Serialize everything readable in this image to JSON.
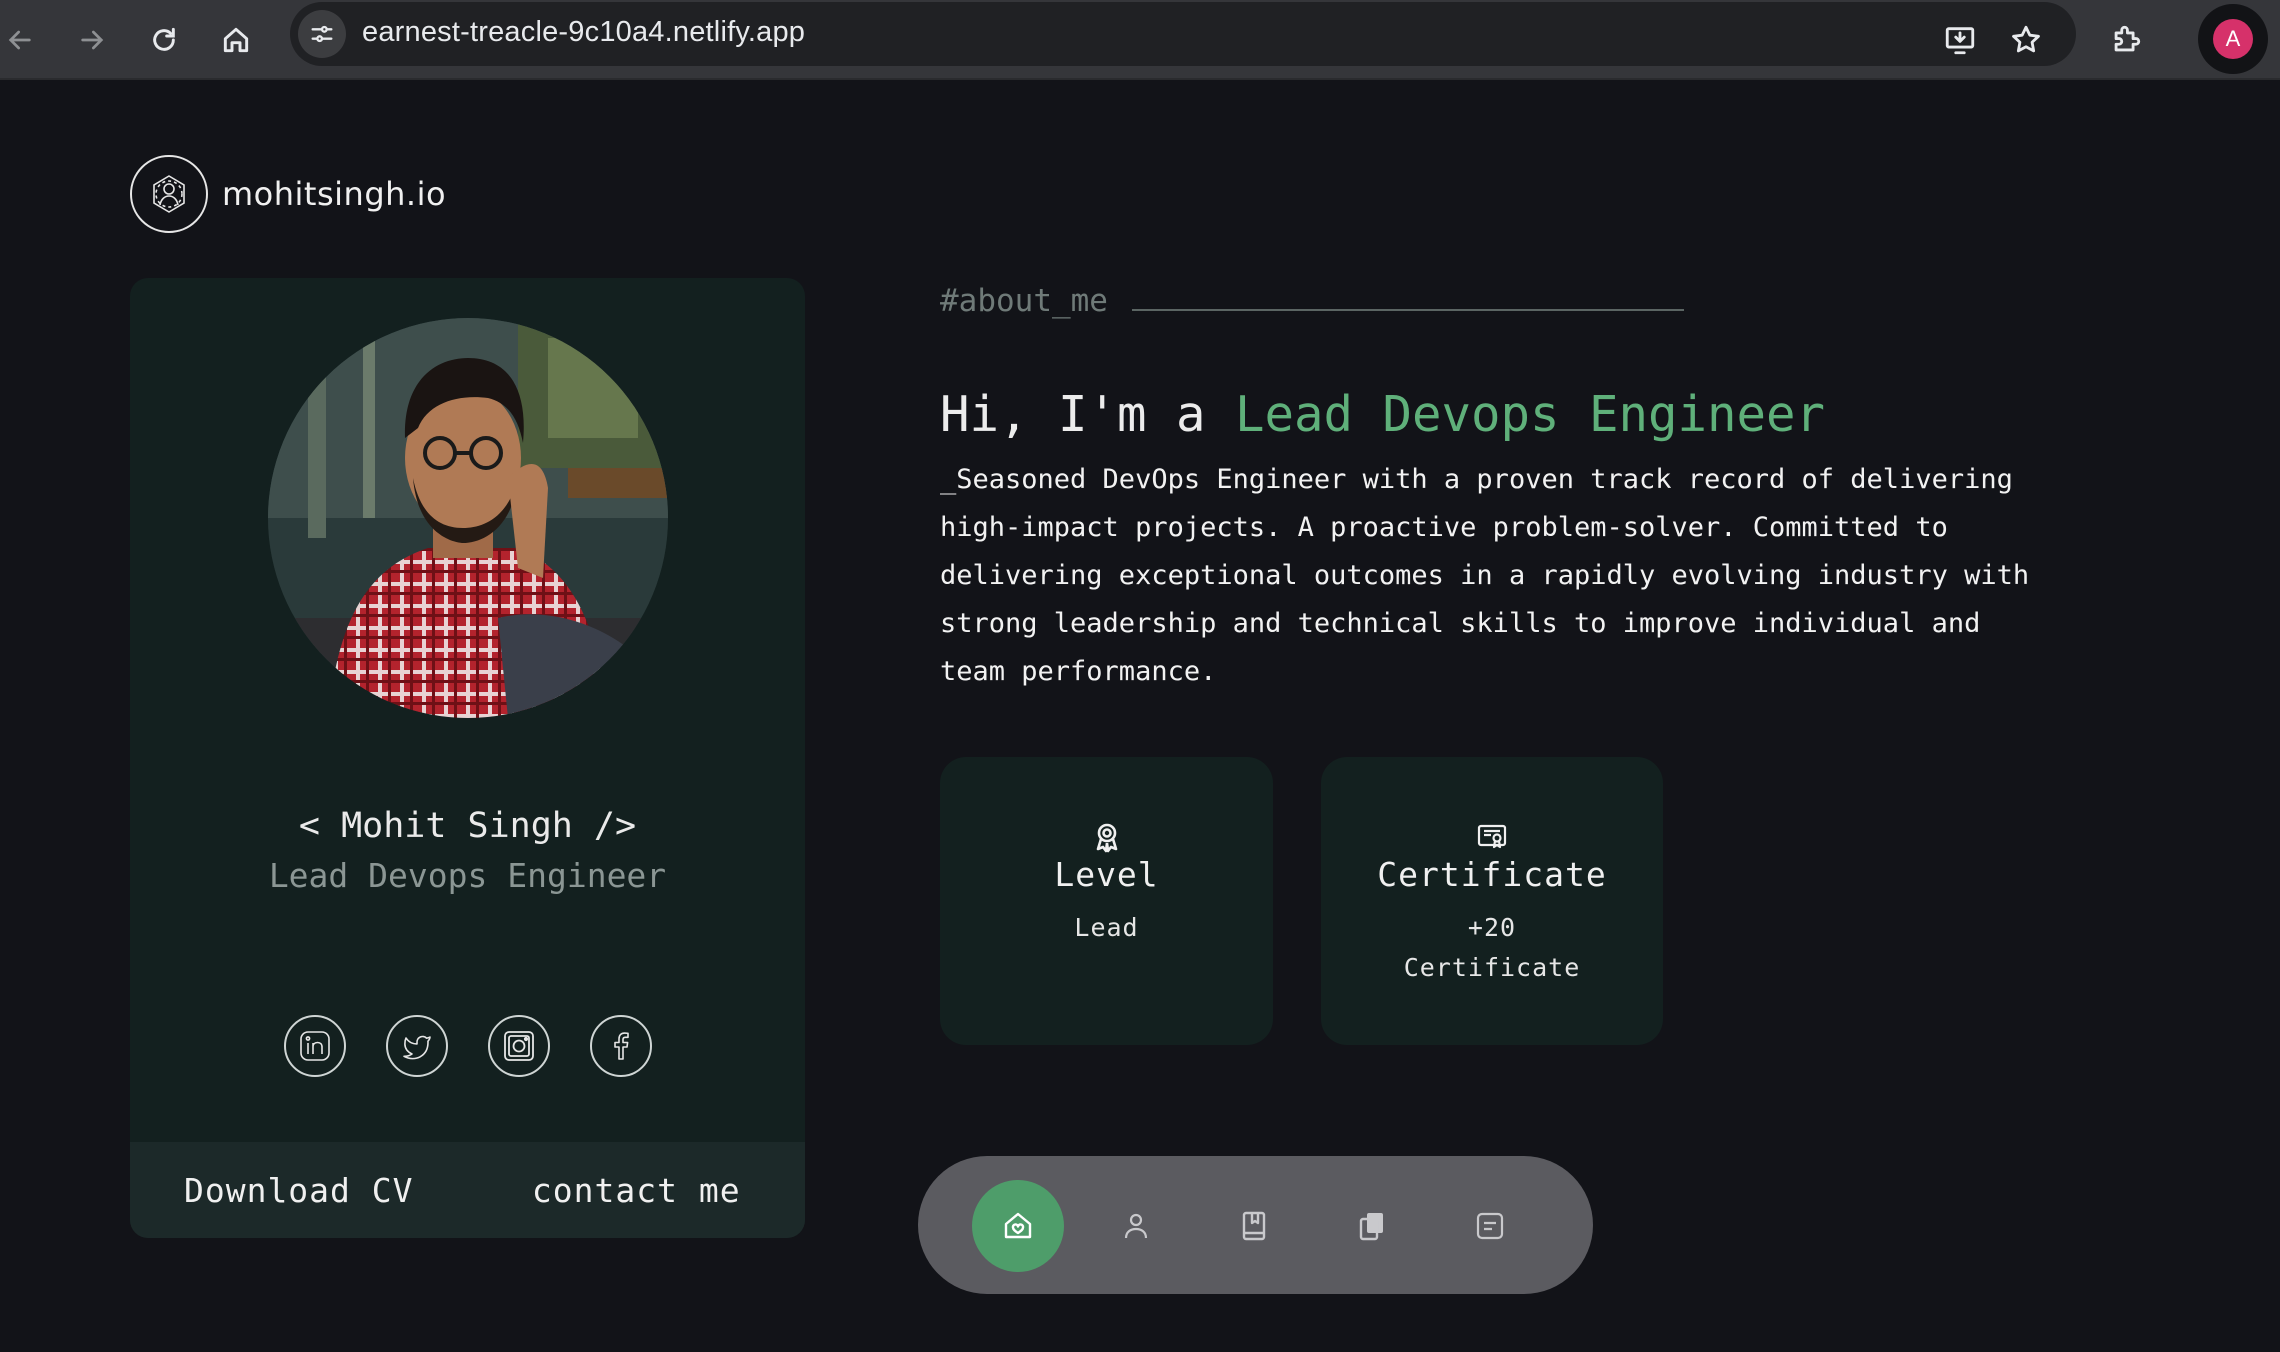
{
  "browser": {
    "url": "earnest-treacle-9c10a4.netlify.app",
    "profile_initial": "A"
  },
  "site": {
    "logo_text": "mohitsingh.io"
  },
  "profile_card": {
    "name": "< Mohit Singh />",
    "role": "Lead Devops Engineer",
    "socials": [
      "linkedin",
      "twitter",
      "instagram",
      "facebook"
    ],
    "download_cv": "Download CV",
    "contact": "contact me"
  },
  "about": {
    "section_tag": "#about_me",
    "greeting": "Hi, I'm a ",
    "title": "Lead Devops Engineer",
    "bio": "_Seasoned DevOps Engineer with a proven track record of delivering high-impact projects. A proactive problem-solver. Committed to delivering exceptional outcomes in a rapidly evolving industry with strong leadership and technical skills to improve individual and team performance."
  },
  "stats": [
    {
      "title": "Level",
      "value": "Lead",
      "icon": "award-icon"
    },
    {
      "title": "Certificate",
      "value": "+20 Certificate",
      "icon": "certificate-icon"
    }
  ],
  "dock": {
    "items": [
      "home",
      "about",
      "resume",
      "portfolio",
      "contact"
    ],
    "active": "home"
  },
  "colors": {
    "accent": "#5fb07a",
    "card_bg": "#13201f",
    "page_bg": "#121318",
    "dock_bg": "#5b5b60",
    "dock_active": "#4e9d6a"
  }
}
